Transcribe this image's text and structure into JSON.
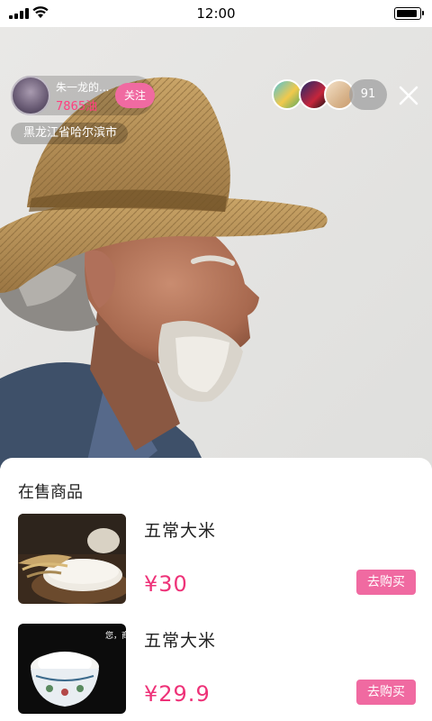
{
  "status_bar": {
    "time": "12:00"
  },
  "host": {
    "name": "朱一龙的...",
    "count": "7865油",
    "follow_label": "关注",
    "location": "黑龙江省哈尔滨市"
  },
  "viewers": {
    "count": "91",
    "avatars": [
      "viewer-avatar-cartoon",
      "viewer-avatar-hero",
      "viewer-avatar-room"
    ]
  },
  "icons": {
    "close": "close-icon",
    "signal": "signal-icon",
    "wifi": "wifi-icon",
    "battery": "battery-icon"
  },
  "products_section": {
    "title": "在售商品",
    "items": [
      {
        "name": "五常大米",
        "price": "¥30",
        "buy_label": "去购买"
      },
      {
        "name": "五常大米",
        "price": "¥29.9",
        "buy_label": "去购买"
      }
    ],
    "thumb2_text": "您，商"
  },
  "colors": {
    "accent_pink": "#f06aa1",
    "price_pink": "#ee3278"
  }
}
